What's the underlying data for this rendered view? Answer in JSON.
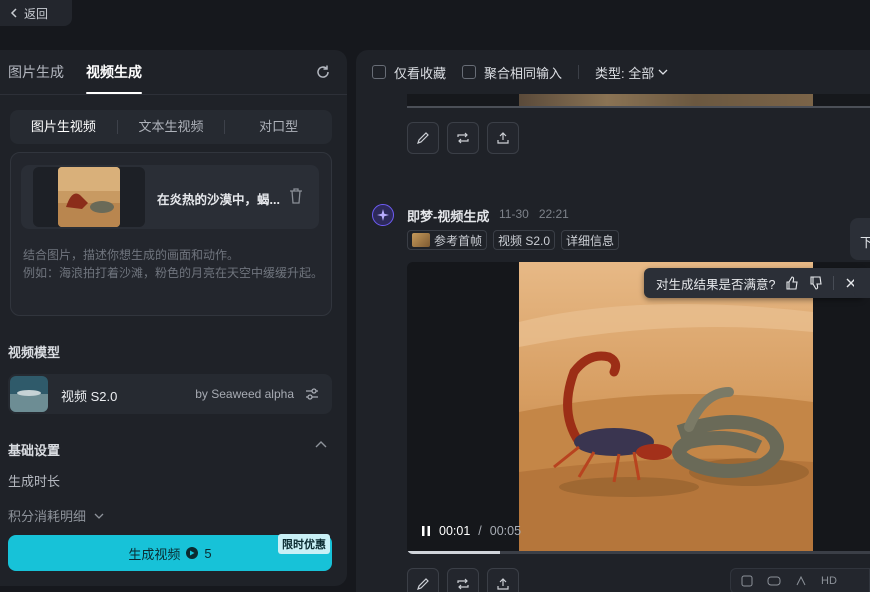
{
  "back": {
    "label": "返回"
  },
  "left": {
    "tabs": [
      "图片生成",
      "视频生成"
    ],
    "active_tab": 1,
    "modes": [
      "图片生视频",
      "文本生视频",
      "对口型"
    ],
    "active_mode": 0,
    "reference": {
      "text": "在炎热的沙漠中，蝎..."
    },
    "hint_line1": "结合图片，描述你想生成的画面和动作。",
    "hint_line2": "例如：海浪拍打着沙滩，粉色的月亮在天空中缓缓升起。",
    "model_section": "视频模型",
    "model": {
      "name": "视频 S2.0",
      "by": "by Seaweed alpha"
    },
    "basic_settings": "基础设置",
    "duration_label": "生成时长",
    "credit_detail": "积分消耗明细",
    "generate": {
      "label": "生成视频",
      "cost": "5",
      "badge": "限时优惠"
    }
  },
  "right": {
    "filters": {
      "favorites": "仅看收藏",
      "merge": "聚合相同输入",
      "type": "类型: 全部"
    },
    "entry": {
      "title": "即梦-视频生成",
      "date": "11-30",
      "time": "22:21",
      "chips": [
        "参考首帧",
        "视频 S2.0",
        "详细信息"
      ]
    },
    "video": {
      "current": "00:01",
      "separator": "/",
      "total": "00:05",
      "progress": 0.2
    },
    "satisfaction": {
      "question": "对生成结果是否满意?"
    },
    "bubble_text": "下",
    "tools": [
      "HD"
    ]
  },
  "colors": {
    "accent": "#17c2d8",
    "avatar_ring": "#6e5cf5",
    "bg": "#16181d",
    "panel": "#1f2228"
  },
  "icons": {
    "back": "chevron-left-icon",
    "refresh": "refresh-icon",
    "trash": "trash-icon",
    "model_settings": "sliders-icon",
    "collapse": "chevron-up-icon",
    "expand": "chevron-down-icon",
    "edit": "pencil-icon",
    "regenerate": "repeat-icon",
    "share": "upload-icon",
    "pause": "pause-icon",
    "thumb_up": "thumbs-up-icon",
    "thumb_down": "thumbs-down-icon",
    "close": "close-icon"
  }
}
